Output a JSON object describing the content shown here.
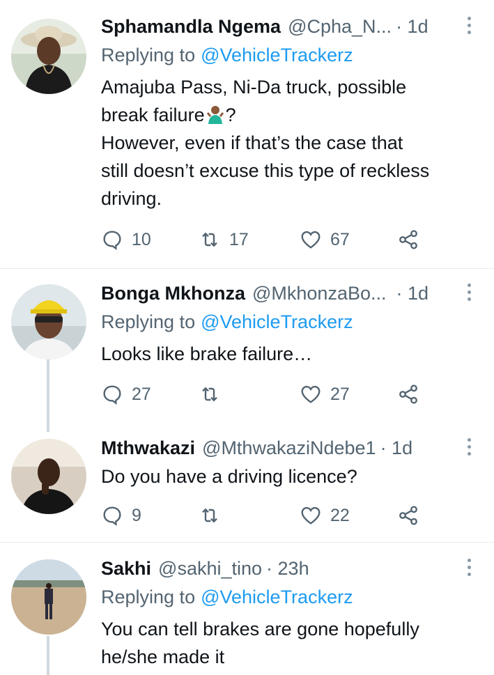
{
  "tweets": [
    {
      "name": "Sphamandla Ngema",
      "handle": "@Cpha_N...",
      "time": "· 1d",
      "replying_label": "Replying to",
      "replying_to": "@VehicleTrackerz",
      "text_lines": [
        "Amajuba Pass, Ni-Da truck, possible",
        "break failure",
        "?",
        "However, even if that’s the case that",
        "still doesn’t excuse this type of reckless",
        "driving."
      ],
      "emoji": "person-shrugging-emoji",
      "replies": "10",
      "retweets": "17",
      "likes": "67"
    },
    {
      "name": "Bonga Mkhonza",
      "handle": "@MkhonzaBo...",
      "time": "· 1d",
      "replying_label": "Replying to",
      "replying_to": "@VehicleTrackerz",
      "text": "Looks like brake failure…",
      "replies": "27",
      "retweets": "",
      "likes": "27"
    },
    {
      "name": "Mthwakazi",
      "handle": "@MthwakaziNdebe1",
      "time": "· 1d",
      "text": "Do you have a driving licence?",
      "replies": "9",
      "retweets": "",
      "likes": "22"
    },
    {
      "name": "Sakhi",
      "handle": "@sakhi_tino",
      "time": "· 23h",
      "replying_label": "Replying to",
      "replying_to": "@VehicleTrackerz",
      "text_lines": [
        "You can tell brakes are gone hopefully",
        "he/she made it"
      ]
    }
  ],
  "icons": {
    "reply": "reply-icon",
    "retweet": "retweet-icon",
    "like": "heart-icon",
    "share": "share-icon",
    "more": "more-options-icon"
  },
  "colors": {
    "link": "#1d9bf0",
    "secondary": "#536471",
    "divider": "#e6ecf0",
    "thread_line": "#cfd9de"
  }
}
